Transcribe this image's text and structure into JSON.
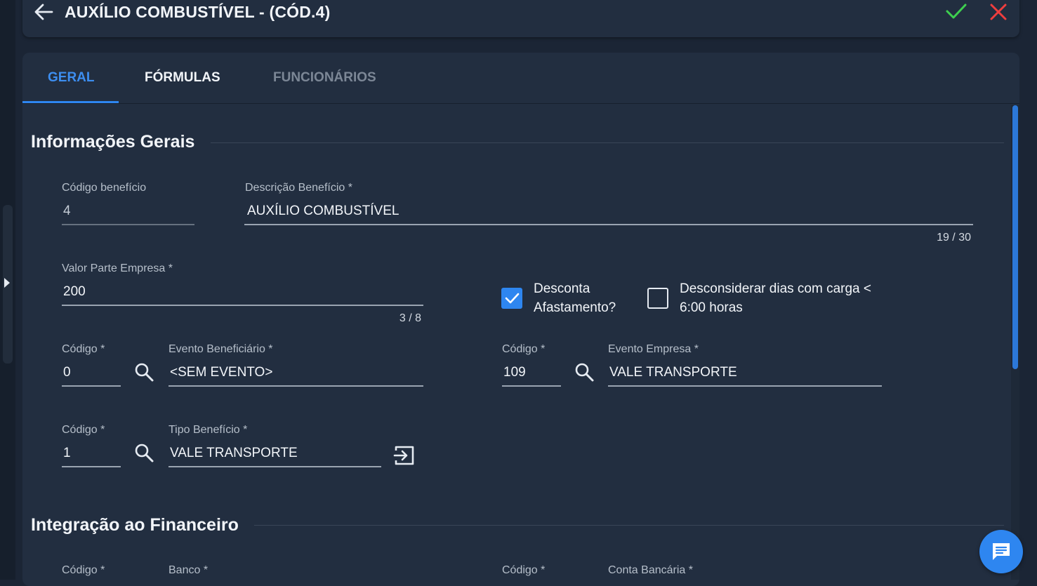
{
  "header": {
    "title": "AUXÍLIO COMBUSTÍVEL - (CÓD.4)"
  },
  "tabs": [
    {
      "label": "GERAL",
      "active": true
    },
    {
      "label": "FÓRMULAS",
      "active": false
    },
    {
      "label": "FUNCIONÁRIOS",
      "active": false
    }
  ],
  "section_general": {
    "title": "Informações Gerais",
    "codigo_beneficio": {
      "label": "Código benefício",
      "value": "4"
    },
    "descricao_beneficio": {
      "label": "Descrição Benefício *",
      "value": "AUXÍLIO COMBUSTÍVEL",
      "counter": "19 / 30"
    },
    "valor_parte_empresa": {
      "label": "Valor Parte Empresa *",
      "value": "200",
      "counter": "3 / 8"
    },
    "desconta_afastamento": {
      "line1": "Desconta",
      "line2": "Afastamento?",
      "checked": true
    },
    "desconsiderar_dias": {
      "line1": "Desconsiderar dias com carga <",
      "line2": "6:00 horas",
      "checked": false
    },
    "evento_beneficiario": {
      "codigo_label": "Código *",
      "codigo_value": "0",
      "label": "Evento Beneficiário *",
      "value": "<SEM EVENTO>"
    },
    "evento_empresa": {
      "codigo_label": "Código *",
      "codigo_value": "109",
      "label": "Evento Empresa *",
      "value": "VALE TRANSPORTE"
    },
    "tipo_beneficio": {
      "codigo_label": "Código *",
      "codigo_value": "1",
      "label": "Tipo Benefício *",
      "value": "VALE TRANSPORTE"
    }
  },
  "section_financeiro": {
    "title": "Integração ao Financeiro",
    "banco": {
      "codigo_label": "Código *",
      "label": "Banco *"
    },
    "conta": {
      "codigo_label": "Código *",
      "label": "Conta Bancária *"
    }
  },
  "colors": {
    "accent": "#2e86f0",
    "confirm": "#3ecf4f",
    "cancel": "#ef3e3e",
    "background": "#1b2535",
    "card": "#222e40"
  },
  "icons": [
    "arrow-left-icon",
    "check-icon",
    "close-icon",
    "search-icon",
    "open-external-icon",
    "chat-icon"
  ]
}
